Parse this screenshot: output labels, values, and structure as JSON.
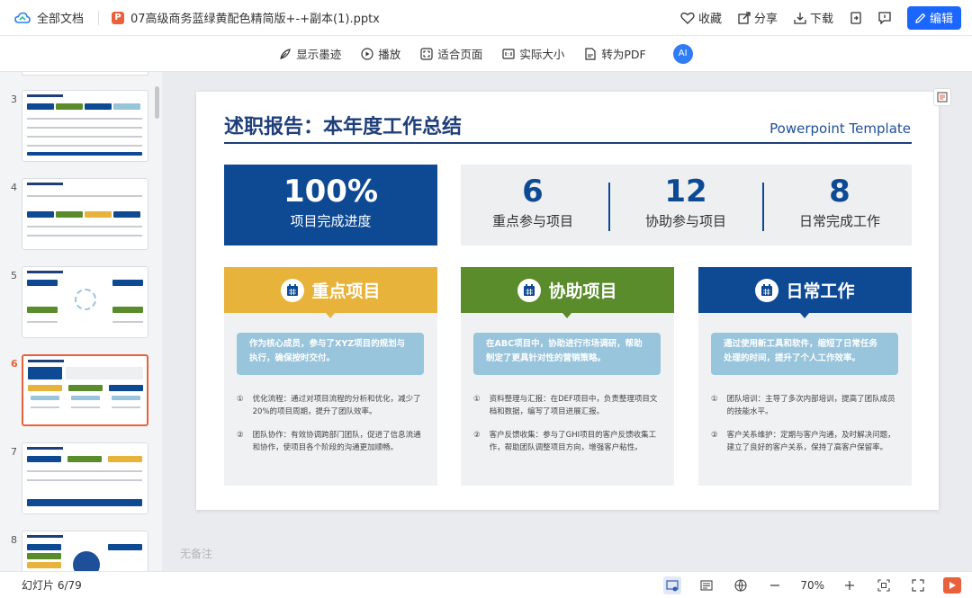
{
  "app": {
    "home_label": "全部文档",
    "ppt_badge": "P",
    "file_name": "07高级商务蓝绿黄配色精简版+-+副本(1).pptx"
  },
  "topbar": {
    "favorite": "收藏",
    "share": "分享",
    "download": "下载",
    "edit": "编辑"
  },
  "toolbar": {
    "show_ink": "显示墨迹",
    "play": "播放",
    "fit_page": "适合页面",
    "actual_size": "实际大小",
    "to_pdf": "转为PDF",
    "ai_badge": "AI"
  },
  "thumbnails": [
    {
      "num": "3"
    },
    {
      "num": "4"
    },
    {
      "num": "5"
    },
    {
      "num": "6",
      "active": true
    },
    {
      "num": "7"
    },
    {
      "num": "8"
    }
  ],
  "slide": {
    "title": "述职报告：本年度工作总结",
    "subtitle": "Powerpoint Template",
    "main_stat": {
      "value": "100%",
      "label": "项目完成进度"
    },
    "stats": [
      {
        "value": "6",
        "label": "重点参与项目"
      },
      {
        "value": "12",
        "label": "协助参与项目"
      },
      {
        "value": "8",
        "label": "日常完成工作"
      }
    ],
    "cards": [
      {
        "title": "重点项目",
        "color": "#e8b33a",
        "desc": "作为核心成员，参与了XYZ项目的规划与执行，确保按时交付。",
        "items": [
          {
            "n": "①",
            "text": "优化流程：通过对项目流程的分析和优化，减少了20%的项目周期，提升了团队效率。"
          },
          {
            "n": "②",
            "text": "团队协作：有效协调跨部门团队，促进了信息流通和协作，使项目各个阶段的沟通更加顺畅。"
          }
        ]
      },
      {
        "title": "协助项目",
        "color": "#5a8c2c",
        "desc": "在ABC项目中，协助进行市场调研，帮助制定了更具针对性的营销策略。",
        "items": [
          {
            "n": "①",
            "text": "资料整理与汇报：在DEF项目中，负责整理项目文档和数据，编写了项目进展汇报。"
          },
          {
            "n": "②",
            "text": "客户反馈收集：参与了GHI项目的客户反馈收集工作，帮助团队调整项目方向，增强客户粘性。"
          }
        ]
      },
      {
        "title": "日常工作",
        "color": "#0e4a94",
        "desc": "通过使用新工具和软件，缩短了日常任务处理的时间，提升了个人工作效率。",
        "items": [
          {
            "n": "①",
            "text": "团队培训：主导了多次内部培训，提高了团队成员的技能水平。"
          },
          {
            "n": "②",
            "text": "客户关系维护：定期与客户沟通，及时解决问题，建立了良好的客户关系，保持了高客户保留率。"
          }
        ]
      }
    ]
  },
  "notes_placeholder": "无备注",
  "status": {
    "slide_count": "幻灯片 6/79",
    "zoom": "70%"
  }
}
